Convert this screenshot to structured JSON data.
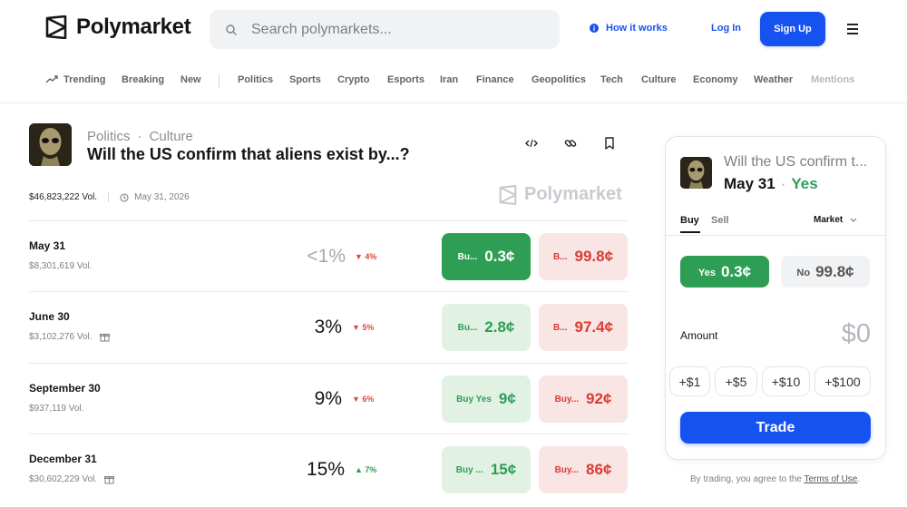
{
  "header": {
    "brand": "Polymarket",
    "search_placeholder": "Search polymarkets...",
    "how_it_works": "How it works",
    "login": "Log In",
    "signup": "Sign Up"
  },
  "nav": {
    "items": [
      "Trending",
      "Breaking",
      "New",
      "Politics",
      "Sports",
      "Crypto",
      "Esports",
      "Iran",
      "Finance",
      "Geopolitics",
      "Tech",
      "Culture",
      "Economy",
      "Weather",
      "Mentions"
    ]
  },
  "market": {
    "category1": "Politics",
    "category2": "Culture",
    "title": "Will the US confirm that aliens exist by...?",
    "volume": "$46,823,222 Vol.",
    "end_date": "May 31, 2026",
    "watermark": "Polymarket",
    "rows": [
      {
        "label": "May 31",
        "volume": "$8,301,619 Vol.",
        "pct": "<1%",
        "change": "4%",
        "yes_label": "Bu...",
        "yes_price": "0.3¢",
        "no_label": "B...",
        "no_price": "99.8¢"
      },
      {
        "label": "June 30",
        "volume": "$3,102,276 Vol.",
        "pct": "3%",
        "change": "5%",
        "yes_label": "Bu...",
        "yes_price": "2.8¢",
        "no_label": "B...",
        "no_price": "97.4¢"
      },
      {
        "label": "September 30",
        "volume": "$937,119 Vol.",
        "pct": "9%",
        "change": "6%",
        "yes_label": "Buy Yes",
        "yes_price": "9¢",
        "no_label": "Buy...",
        "no_price": "92¢"
      },
      {
        "label": "December 31",
        "volume": "$30,602,229 Vol.",
        "pct": "15%",
        "change": "7%",
        "yes_label": "Buy ...",
        "yes_price": "15¢",
        "no_label": "Buy...",
        "no_price": "86¢"
      }
    ]
  },
  "panel": {
    "question": "Will the US confirm t...",
    "outcome": "May 31",
    "side": "Yes",
    "tab_buy": "Buy",
    "tab_sell": "Sell",
    "order_type": "Market",
    "yes_label": "Yes",
    "yes_price": "0.3¢",
    "no_label": "No",
    "no_price": "99.8¢",
    "amount_label": "Amount",
    "amount_value": "$0",
    "quick": [
      "+$1",
      "+$5",
      "+$10",
      "+$100"
    ],
    "trade": "Trade"
  },
  "footer": {
    "terms_prefix": "By trading, you agree to the",
    "terms_link": "Terms of Use",
    "terms_suffix": "."
  },
  "colors": {
    "brand_blue": "#1652f0",
    "yes_green": "#2f9e55",
    "no_red": "#dc3b33"
  }
}
